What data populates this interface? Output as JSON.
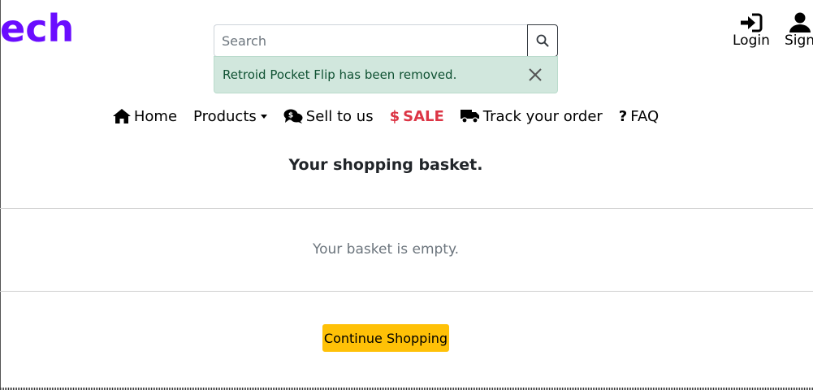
{
  "brand": {
    "logo_text": "ech",
    "color": "#6a0dff"
  },
  "search": {
    "placeholder": "Search",
    "value": "",
    "button_icon": "search-icon"
  },
  "alert": {
    "message": "Retroid Pocket Flip has been removed.",
    "close_icon": "close-icon",
    "bg_color": "#d1e7dd"
  },
  "account": {
    "login_label": "Login",
    "signup_label": "Sign"
  },
  "nav": {
    "home": "Home",
    "products": "Products",
    "sell": "Sell to us",
    "sale": "SALE",
    "sale_color": "#dc3545",
    "track": "Track your order",
    "faq": "FAQ"
  },
  "basket": {
    "title": "Your shopping basket.",
    "empty_message": "Your basket is empty.",
    "continue_label": "Continue Shopping",
    "continue_color": "#ffc107"
  }
}
